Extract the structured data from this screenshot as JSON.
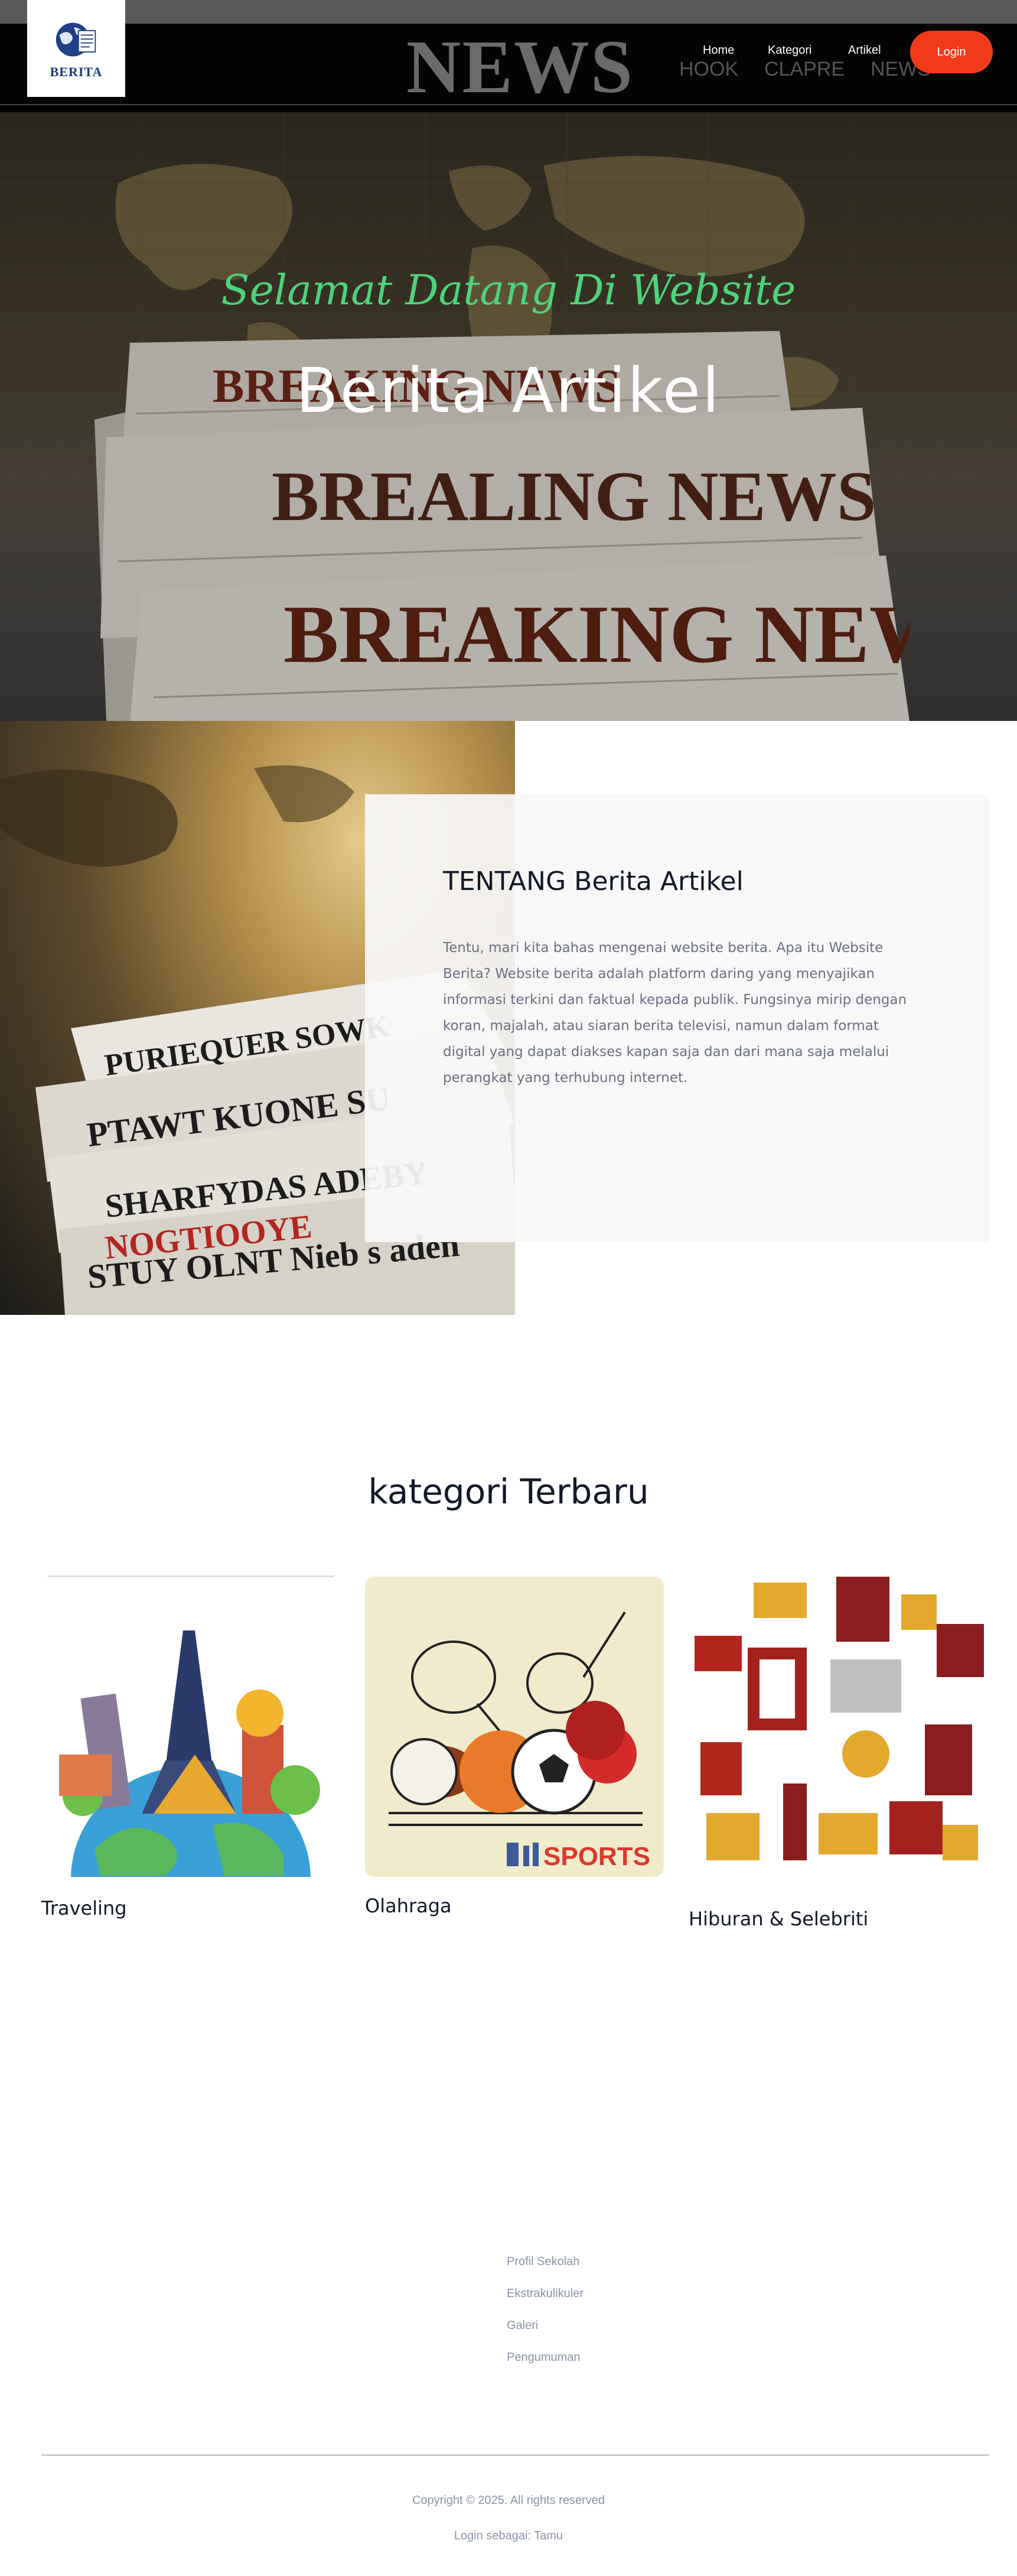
{
  "header": {
    "logo_text": "BERITA",
    "background_word": "NEWS",
    "background_subwords": [
      "HOOK",
      "CLAPRE",
      "NEWS"
    ],
    "nav": [
      "Home",
      "Kategori",
      "Artikel"
    ],
    "login_label": "Login",
    "accent": "#f13b1b"
  },
  "hero": {
    "welcome": "Selamat Datang Di Website",
    "title": "Berita Artikel",
    "welcome_color": "#4ed37a",
    "paper_headlines": [
      "BREAKING NEWS",
      "BREALING NEWS",
      "BREAKING NEWS"
    ]
  },
  "about": {
    "heading": "TENTANG Berita Artikel",
    "body": "Tentu, mari kita bahas mengenai website berita. Apa itu Website Berita? Website berita adalah platform daring yang menyajikan informasi terkini dan faktual kepada publik. Fungsinya mirip dengan koran, majalah, atau siaran berita televisi, namun dalam format digital yang dapat diakses kapan saja dan dari mana saja melalui perangkat yang terhubung internet."
  },
  "categories": {
    "heading": "kategori Terbaru",
    "items": [
      {
        "label": "Traveling",
        "icon": "travel-illustration-icon"
      },
      {
        "label": "Olahraga",
        "icon": "sports-illustration-icon",
        "image_text": "SPORTS"
      },
      {
        "label": "Hiburan & Selebriti",
        "icon": "entertainment-illustration-icon"
      }
    ]
  },
  "footer": {
    "links": [
      "Profil Sekolah",
      "Ekstrakulikuler",
      "Galeri",
      "Pengumuman"
    ],
    "copyright": "Copyright © 2025. All rights reserved",
    "login_status": "Login sebagai: Tamu"
  }
}
